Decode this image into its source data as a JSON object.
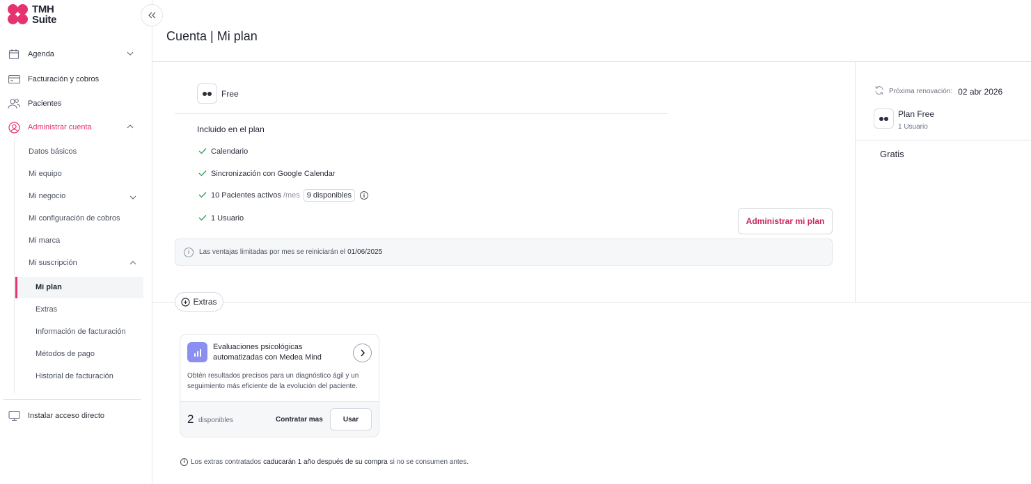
{
  "brand": {
    "name_line1": "TMH",
    "name_line2": "Suite",
    "accent": "#e6336e"
  },
  "sidebar": {
    "collapse_icon": "double-chevron-left-icon",
    "items": [
      {
        "label": "Agenda",
        "icon": "calendar-icon"
      },
      {
        "label": "Facturación y cobros",
        "icon": "card-icon"
      },
      {
        "label": "Pacientes",
        "icon": "users-icon"
      },
      {
        "label": "Administrar cuenta",
        "icon": "user-circle-icon"
      }
    ],
    "account_sub": [
      {
        "label": "Datos básicos"
      },
      {
        "label": "Mi equipo"
      },
      {
        "label": "Mi negocio"
      },
      {
        "label": "Mi configuración de cobros"
      },
      {
        "label": "Mi marca"
      },
      {
        "label": "Mi suscripción"
      }
    ],
    "subscription_sub": [
      {
        "label": "Mi plan"
      },
      {
        "label": "Extras"
      },
      {
        "label": "Información de facturación"
      },
      {
        "label": "Métodos de pago"
      },
      {
        "label": "Historial de facturación"
      }
    ],
    "install": {
      "label": "Instalar acceso directo",
      "icon": "monitor-icon"
    }
  },
  "header": {
    "title": "Cuenta | Mi plan"
  },
  "plan": {
    "name": "Free",
    "included_title": "Incluido en el plan",
    "features": [
      {
        "label": "Calendario"
      },
      {
        "label": "Sincronización con Google Calendar"
      },
      {
        "label": "10 Pacientes activos",
        "suffix": "/mes",
        "badge": "9 disponibles"
      },
      {
        "label": "1 Usuario"
      }
    ],
    "manage_button": "Administrar mi plan",
    "notice_prefix": "Las ventajas limitadas por mes se reiniciarán el",
    "notice_date": "01/06/2025"
  },
  "summary": {
    "renewal_label": "Próxima renovación:",
    "renewal_date": "02 abr 2026",
    "plan_name": "Plan Free",
    "plan_users": "1 Usuario",
    "price": "Gratis"
  },
  "extras": {
    "tab_label": "Extras",
    "card": {
      "title_line1": "Evaluaciones psicológicas",
      "title_line2": "automatizadas con Medea Mind",
      "desc_line1": "Obtén resultados precisos para un diagnóstico ágil y un",
      "desc_line2": "seguimiento más eficiente de la evolución del paciente.",
      "count": "2",
      "count_label": "disponibles",
      "buy_label": "Contratar mas",
      "use_label": "Usar"
    },
    "footer_prefix": "Los extras contratados",
    "footer_bold": "caducarán 1 año después de su compra",
    "footer_suffix": "si no se consumen antes."
  }
}
